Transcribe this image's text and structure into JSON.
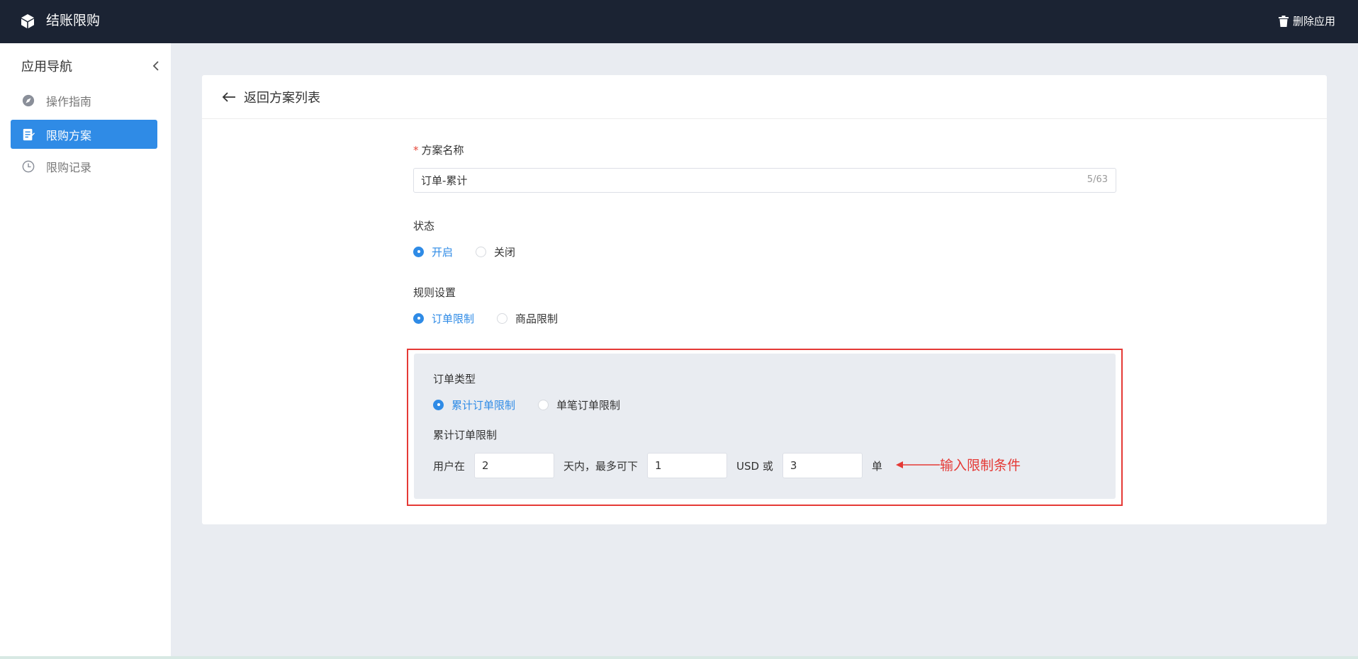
{
  "header": {
    "app_title": "结账限购",
    "delete_app_label": "删除应用"
  },
  "sidebar": {
    "title": "应用导航",
    "items": [
      {
        "label": "操作指南",
        "icon": "compass-icon"
      },
      {
        "label": "限购方案",
        "icon": "document-icon",
        "active": true
      },
      {
        "label": "限购记录",
        "icon": "clock-icon"
      }
    ]
  },
  "page": {
    "back_label": "返回方案列表"
  },
  "form": {
    "name_label": "方案名称",
    "name_value": "订单-累计",
    "name_count": "5/63",
    "status_label": "状态",
    "status_options": [
      "开启",
      "关闭"
    ],
    "status_selected": "开启",
    "rule_label": "规则设置",
    "rule_options": [
      "订单限制",
      "商品限制"
    ],
    "rule_selected": "订单限制",
    "order_type_label": "订单类型",
    "order_type_options": [
      "累计订单限制",
      "单笔订单限制"
    ],
    "order_type_selected": "累计订单限制",
    "cumulative_label": "累计订单限制",
    "limit_prefix": "用户在",
    "days_value": "2",
    "limit_mid": "天内，最多可下",
    "amount_value": "1",
    "limit_currency": "USD 或",
    "orders_value": "3",
    "limit_suffix": "单"
  },
  "annotation": {
    "text": "输入限制条件"
  },
  "colors": {
    "topbar": "#1b2333",
    "accent": "#2f8be6",
    "annotation_red": "#e53935",
    "background": "#e9ecf1"
  }
}
